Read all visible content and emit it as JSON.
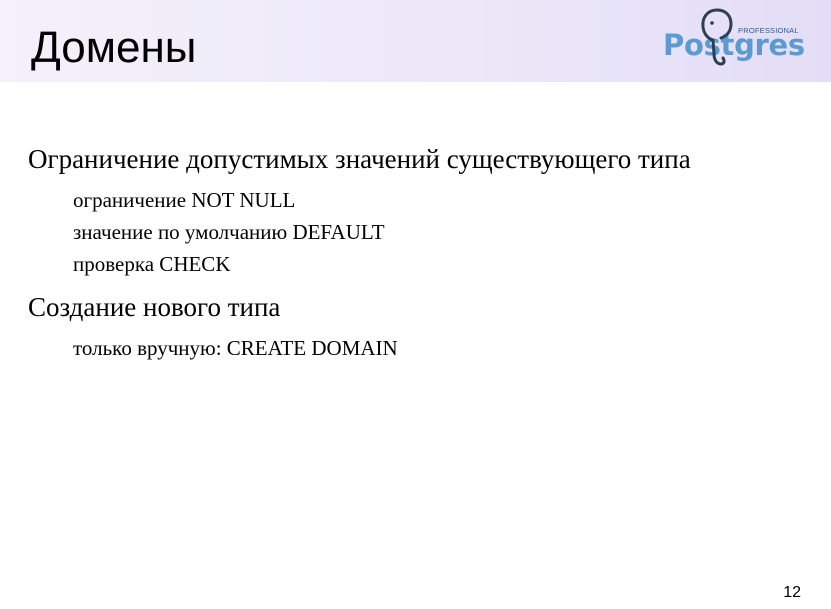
{
  "slide": {
    "title": "Домены",
    "page_number": "12"
  },
  "logo": {
    "tagline": "PROFESSIONAL",
    "wordmark": "Postgres",
    "icon": "elephant-icon",
    "color": "#5b9bd2"
  },
  "sections": [
    {
      "heading": "Ограничение допустимых значений существующего типа",
      "items": [
        "ограничение NOT NULL",
        "значение по умолчанию DEFAULT",
        "проверка CHECK"
      ]
    },
    {
      "heading": "Создание нового типа",
      "items": [
        "только вручную: CREATE DOMAIN"
      ]
    }
  ]
}
